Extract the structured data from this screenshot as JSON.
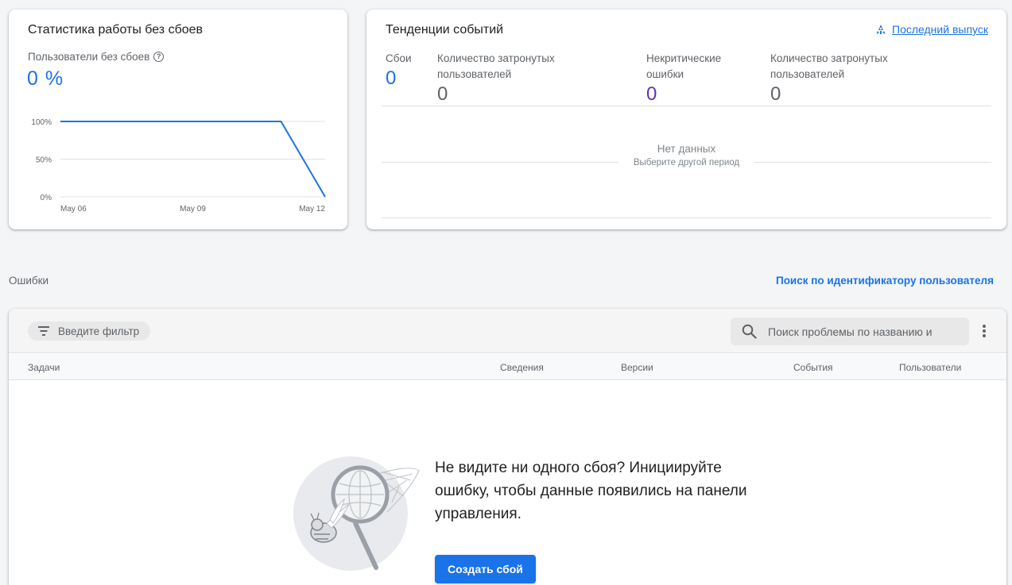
{
  "colors": {
    "accent": "#1a73e8",
    "purple": "#5e35b1",
    "muted": "#5f6368"
  },
  "stability": {
    "title": "Статистика работы без сбоев",
    "metric_label": "Пользователи без сбоев",
    "metric_value": "0 %",
    "help_icon": "help-circle-icon"
  },
  "chart_data": {
    "type": "line",
    "x": [
      "May 06",
      "May 07",
      "May 08",
      "May 09",
      "May 10",
      "May 11",
      "May 12"
    ],
    "series": [
      {
        "values": [
          100,
          100,
          100,
          100,
          100,
          100,
          0
        ]
      }
    ],
    "x_ticks": [
      "May 06",
      "May 09",
      "May 12"
    ],
    "y_ticks": [
      "100%",
      "50%",
      "0%"
    ],
    "ylim": [
      0,
      100
    ],
    "grid": true,
    "title": "",
    "xlabel": "",
    "ylabel": ""
  },
  "trends": {
    "title": "Тенденции событий",
    "release_link": "Последний выпуск",
    "release_icon": "release-icon",
    "stats": [
      {
        "label": "Сбои",
        "value": "0"
      },
      {
        "label": "Количество затронутых пользователей",
        "value": "0"
      },
      {
        "label": "Некритические ошибки",
        "value": "0"
      },
      {
        "label": "Количество затронутых пользователей",
        "value": "0"
      }
    ],
    "no_data": "Нет данных",
    "no_data_hint": "Выберите другой период"
  },
  "section": {
    "errors_label": "Ошибки",
    "user_search_link": "Поиск по идентификатору пользователя"
  },
  "issues": {
    "filter_label": "Введите фильтр",
    "search_placeholder": "Поиск проблемы по названию и",
    "columns": [
      "Задачи",
      "Сведения",
      "Версии",
      "События",
      "Пользователи"
    ],
    "empty_message": "Не видите ни одного сбоя? Инициируйте ошибку, чтобы данные появились на панели управления.",
    "cta_label": "Создать сбой"
  }
}
